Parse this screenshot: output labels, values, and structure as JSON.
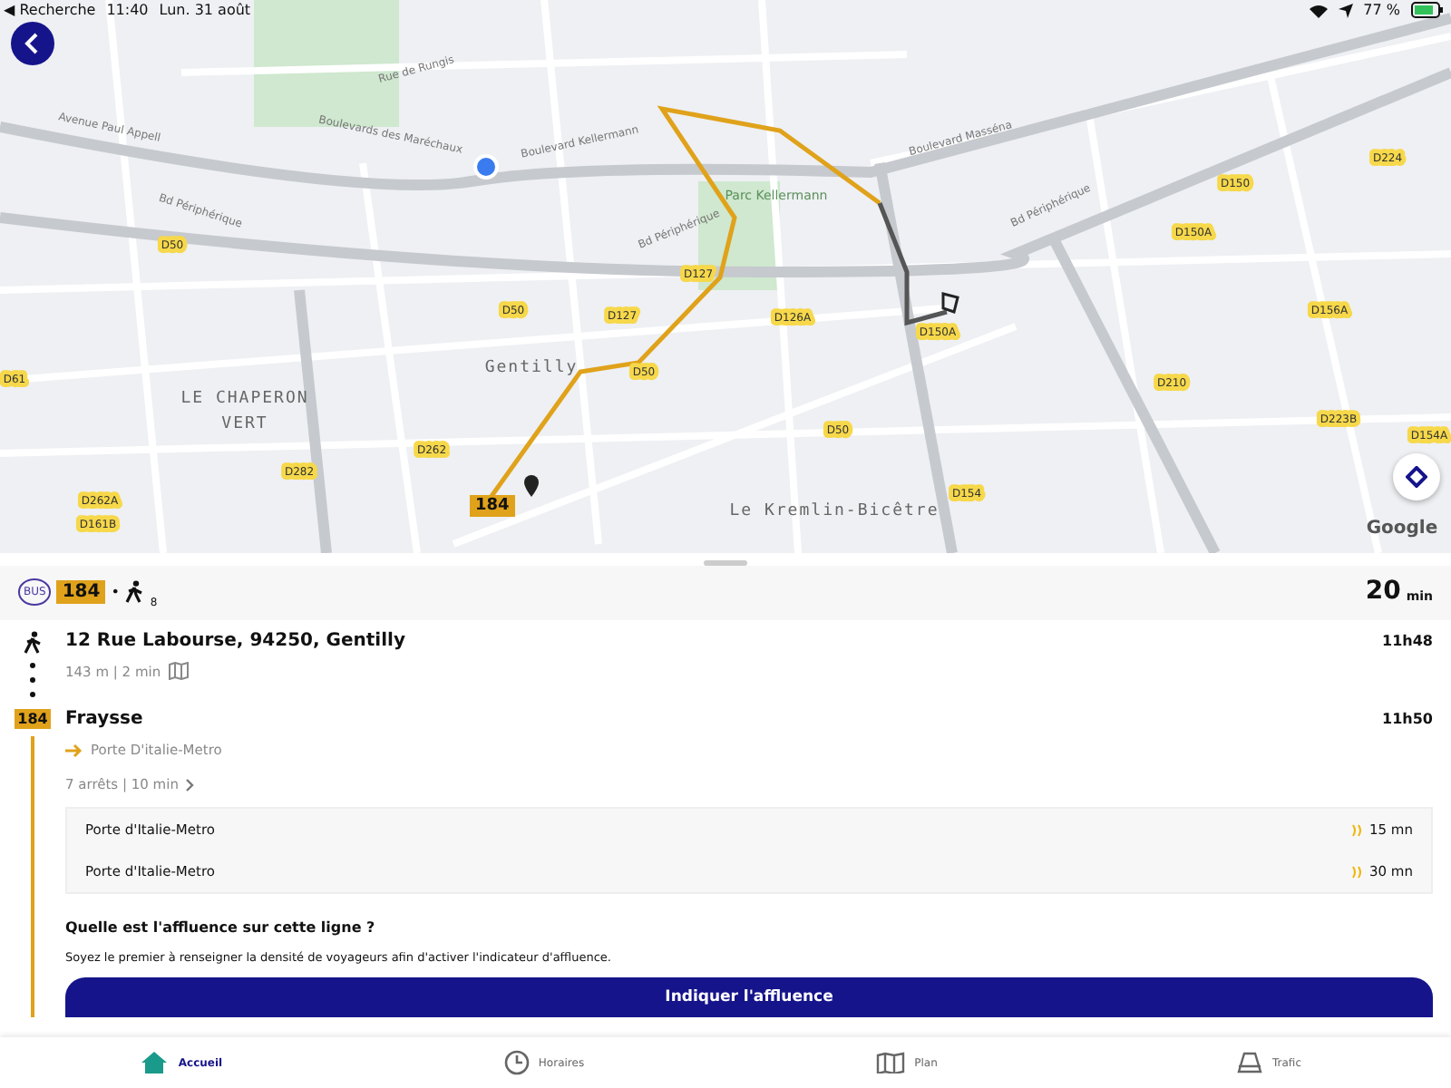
{
  "status_bar": {
    "back_app": "◀ Recherche",
    "time": "11:40",
    "date": "Lun. 31 août",
    "battery": "77 %"
  },
  "map": {
    "labels": [
      {
        "kind": "road",
        "text": "Avenue Paul Appell"
      },
      {
        "kind": "road",
        "text": "Rue de Rungis"
      },
      {
        "kind": "road",
        "text": "Boulevards des Maréchaux"
      },
      {
        "kind": "road",
        "text": "Boulevard Kellermann"
      },
      {
        "kind": "road",
        "text": "Boulevard Masséna"
      },
      {
        "kind": "road",
        "text": "Bd Périphérique"
      },
      {
        "kind": "road",
        "text": "Bd Périphérique"
      },
      {
        "kind": "road",
        "text": "Bd Périphérique"
      },
      {
        "kind": "park",
        "text": "Parc Kellermann"
      },
      {
        "kind": "place",
        "text": "Gentilly"
      },
      {
        "kind": "place",
        "text": "LE CHAPERON"
      },
      {
        "kind": "place",
        "text": "VERT"
      },
      {
        "kind": "place",
        "text": "Le Kremlin-Bicêtre"
      },
      {
        "kind": "code",
        "text": "D50"
      },
      {
        "kind": "code",
        "text": "D50"
      },
      {
        "kind": "code",
        "text": "D127"
      },
      {
        "kind": "code",
        "text": "D127"
      },
      {
        "kind": "code",
        "text": "D50"
      },
      {
        "kind": "code",
        "text": "D126A"
      },
      {
        "kind": "code",
        "text": "D150A"
      },
      {
        "kind": "code",
        "text": "D150"
      },
      {
        "kind": "code",
        "text": "D150A"
      },
      {
        "kind": "code",
        "text": "D224"
      },
      {
        "kind": "code",
        "text": "D156A"
      },
      {
        "kind": "code",
        "text": "D210"
      },
      {
        "kind": "code",
        "text": "D223B"
      },
      {
        "kind": "code",
        "text": "D154A"
      },
      {
        "kind": "code",
        "text": "D50"
      },
      {
        "kind": "code",
        "text": "D154"
      },
      {
        "kind": "code",
        "text": "D262"
      },
      {
        "kind": "code",
        "text": "D282"
      },
      {
        "kind": "code",
        "text": "D262A"
      },
      {
        "kind": "code",
        "text": "D161B"
      },
      {
        "kind": "code",
        "text": "D61"
      }
    ],
    "line_badge": "184",
    "attribution": "Google"
  },
  "summary": {
    "mode": "BUS",
    "line": "184",
    "separator": "•",
    "walk_minutes": "8",
    "duration": "20",
    "duration_unit": "min"
  },
  "steps": [
    {
      "kind": "walk",
      "title": "12 Rue Labourse, 94250, Gentilly",
      "detail": "143 m | 2 min",
      "time": "11h48"
    },
    {
      "kind": "bus",
      "line": "184",
      "title": "Fraysse",
      "direction": "Porte D'italie-Metro",
      "detail": "7 arrêts | 10 min",
      "time": "11h50",
      "departures": [
        {
          "destination": "Porte d'Italie-Metro",
          "wait": "15 mn"
        },
        {
          "destination": "Porte d'Italie-Metro",
          "wait": "30 mn"
        }
      ]
    }
  ],
  "crowding": {
    "question": "Quelle est l'affluence sur cette ligne ?",
    "text": "Soyez le premier à renseigner la densité de voyageurs afin d'activer l'indicateur d'affluence.",
    "button": "Indiquer l'affluence"
  },
  "tab_bar": [
    {
      "label": "Accueil",
      "selected": true
    },
    {
      "label": "Horaires",
      "selected": false
    },
    {
      "label": "Plan",
      "selected": false
    },
    {
      "label": "Trafic",
      "selected": false
    }
  ]
}
